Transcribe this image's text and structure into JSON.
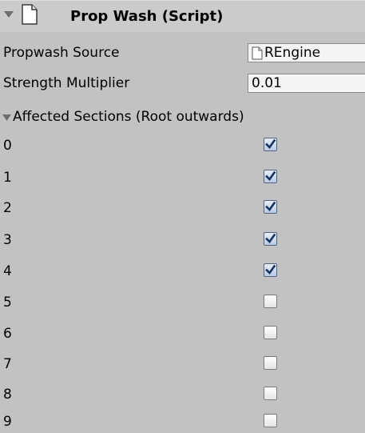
{
  "component": {
    "title": "Prop Wash (Script)"
  },
  "fields": {
    "propwash_source": {
      "label": "Propwash Source",
      "value": "REngine"
    },
    "strength_multiplier": {
      "label": "Strength Multiplier",
      "value": "0.01"
    }
  },
  "affected_sections": {
    "label": "Affected Sections (Root outwards)",
    "items": [
      {
        "label": "0",
        "checked": true
      },
      {
        "label": "1",
        "checked": true
      },
      {
        "label": "2",
        "checked": true
      },
      {
        "label": "3",
        "checked": true
      },
      {
        "label": "4",
        "checked": true
      },
      {
        "label": "5",
        "checked": false
      },
      {
        "label": "6",
        "checked": false
      },
      {
        "label": "7",
        "checked": false
      },
      {
        "label": "8",
        "checked": false
      },
      {
        "label": "9",
        "checked": false
      }
    ]
  }
}
